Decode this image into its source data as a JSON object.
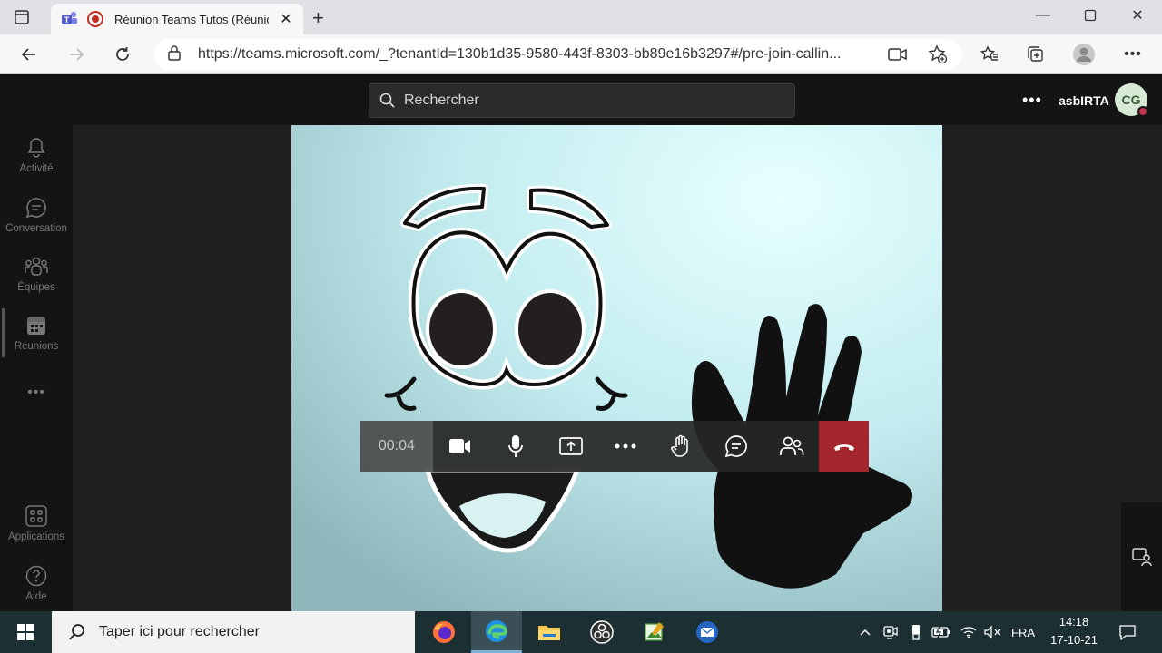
{
  "browser": {
    "tab_title": "Réunion Teams Tutos (Réunion",
    "url": "https://teams.microsoft.com/_?tenantId=130b1d35-9580-443f-8303-bb89e16b3297#/pre-join-callin..."
  },
  "teams": {
    "search_placeholder": "Rechercher",
    "more_label": "•••",
    "org_name": "asbIRTA",
    "avatar_initials": "CG",
    "rail": {
      "activity": "Activité",
      "chat": "Conversation",
      "teams": "Équipes",
      "meetings": "Réunions",
      "more": "•••",
      "apps": "Applications",
      "help": "Aide"
    },
    "call": {
      "timer": "00:04"
    }
  },
  "taskbar": {
    "search_placeholder": "Taper ici pour rechercher",
    "language": "FRA",
    "time": "14:18",
    "date": "17-10-21"
  },
  "colors": {
    "hangup": "#a4262c",
    "accent": "#c4314b"
  }
}
